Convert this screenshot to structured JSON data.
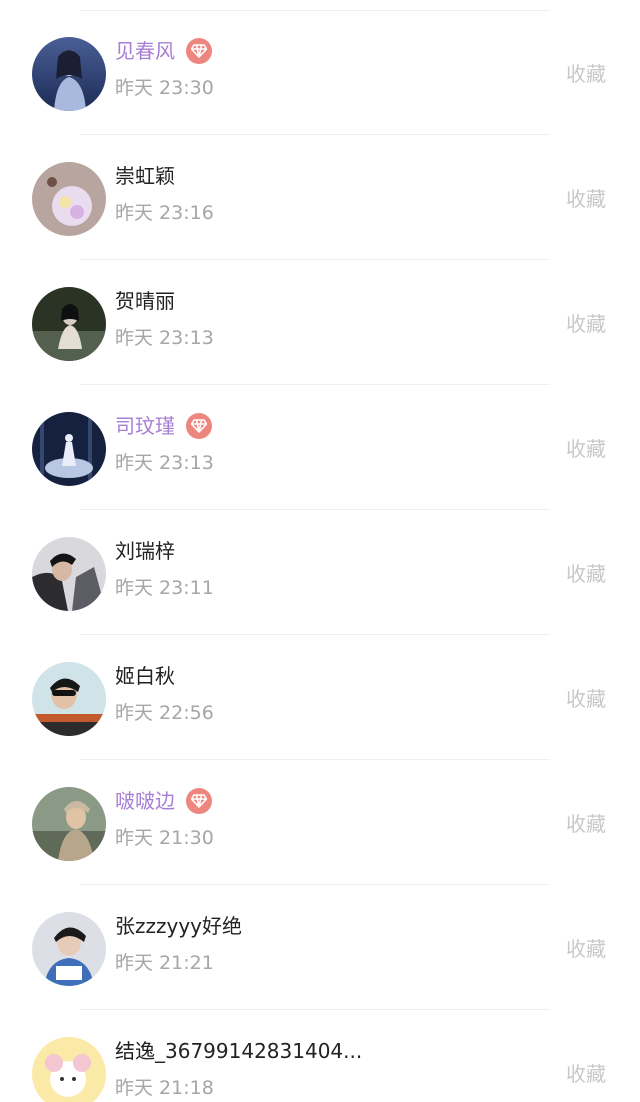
{
  "rows": [
    {
      "name": "见春风",
      "time": "昨天 23:30",
      "action": "收藏",
      "vip": true
    },
    {
      "name": "崇虹颖",
      "time": "昨天 23:16",
      "action": "收藏",
      "vip": false
    },
    {
      "name": "贺晴丽",
      "time": "昨天 23:13",
      "action": "收藏",
      "vip": false
    },
    {
      "name": "司玟瑾",
      "time": "昨天 23:13",
      "action": "收藏",
      "vip": true
    },
    {
      "name": "刘瑞梓",
      "time": "昨天 23:11",
      "action": "收藏",
      "vip": false
    },
    {
      "name": "姬白秋",
      "time": "昨天 22:56",
      "action": "收藏",
      "vip": false
    },
    {
      "name": "啵啵边",
      "time": "昨天 21:30",
      "action": "收藏",
      "vip": true
    },
    {
      "name": "张zzzyyy好绝",
      "time": "昨天 21:21",
      "action": "收藏",
      "vip": false
    },
    {
      "name": "结逸_36799142831404...",
      "time": "昨天 21:18",
      "action": "收藏",
      "vip": false
    }
  ],
  "colors": {
    "vip_name": "#a77fd6",
    "normal_name": "#222222",
    "time": "#a6a6a6",
    "action": "#c8c8c8",
    "vip_badge": "#ee8680"
  },
  "icons": {
    "vip_badge": "diamond-icon"
  }
}
